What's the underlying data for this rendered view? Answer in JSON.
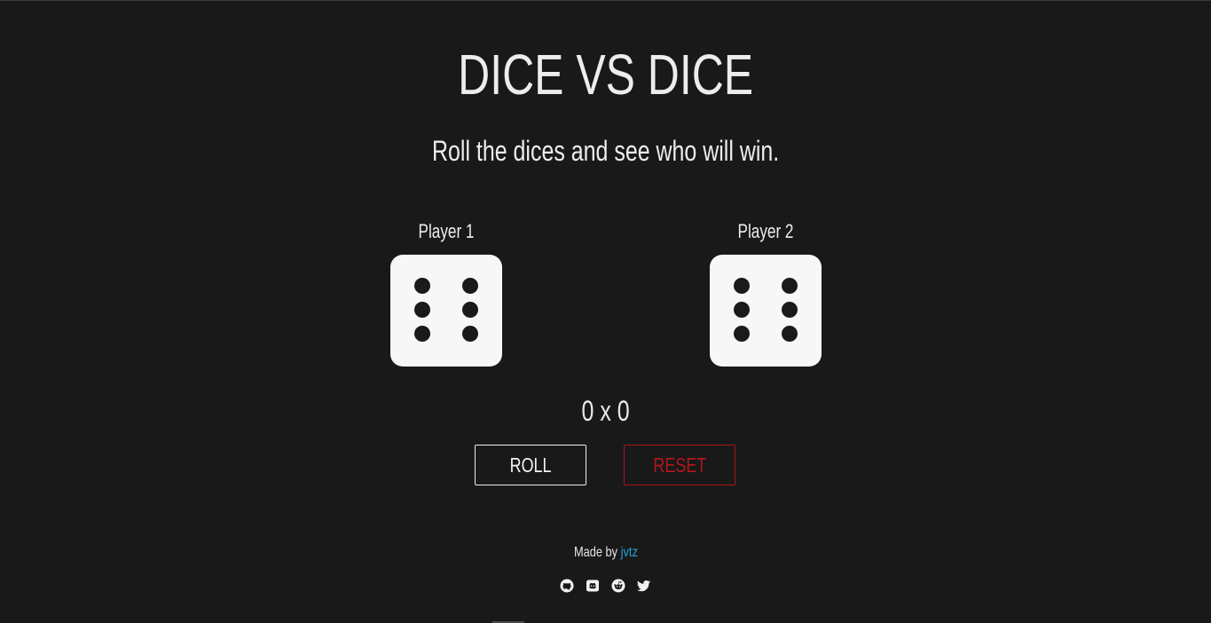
{
  "header": {
    "title": "DICE VS DICE",
    "subtitle": "Roll the dices and see who will win."
  },
  "players": [
    {
      "label": "Player 1",
      "die_value": 6
    },
    {
      "label": "Player 2",
      "die_value": 6
    }
  ],
  "score": {
    "text": "0 x 0"
  },
  "buttons": {
    "roll": "ROLL",
    "reset": "RESET"
  },
  "footer": {
    "made_by_prefix": "Made by",
    "author": "jvtz"
  },
  "socials": [
    {
      "icon": "github-icon"
    },
    {
      "icon": "discord-icon"
    },
    {
      "icon": "reddit-icon"
    },
    {
      "icon": "twitter-icon"
    }
  ],
  "colors": {
    "background": "#191919",
    "die_face": "#f7f7f7",
    "reset_accent": "#a4161a",
    "link_accent": "#2aa2d6"
  }
}
